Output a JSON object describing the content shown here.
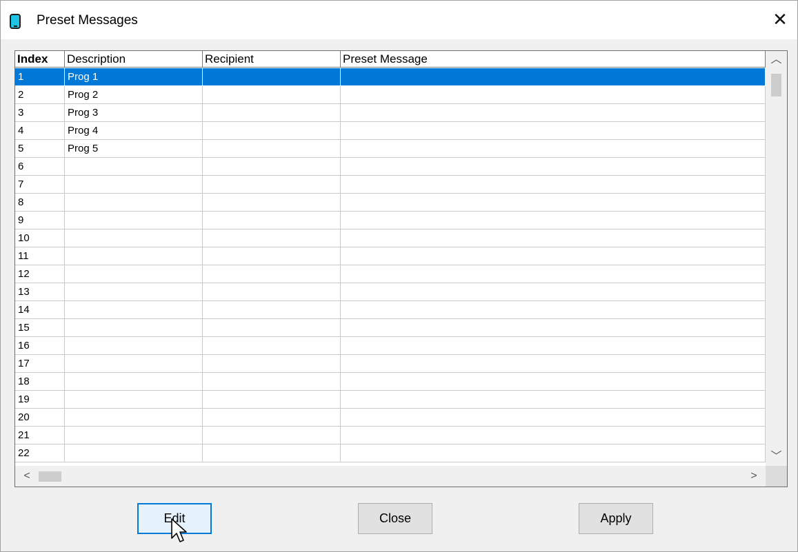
{
  "window": {
    "title": "Preset Messages",
    "icon": "mobile-device-icon",
    "close_icon": "close-icon"
  },
  "table": {
    "columns": [
      "Index",
      "Description",
      "Recipient",
      "Preset Message"
    ],
    "selected_index": 0,
    "rows": [
      [
        "1",
        "Prog 1",
        "",
        ""
      ],
      [
        "2",
        "Prog 2",
        "",
        ""
      ],
      [
        "3",
        "Prog 3",
        "",
        ""
      ],
      [
        "4",
        "Prog 4",
        "",
        ""
      ],
      [
        "5",
        "Prog 5",
        "",
        ""
      ],
      [
        "6",
        "",
        "",
        ""
      ],
      [
        "7",
        "",
        "",
        ""
      ],
      [
        "8",
        "",
        "",
        ""
      ],
      [
        "9",
        "",
        "",
        ""
      ],
      [
        "10",
        "",
        "",
        ""
      ],
      [
        "11",
        "",
        "",
        ""
      ],
      [
        "12",
        "",
        "",
        ""
      ],
      [
        "13",
        "",
        "",
        ""
      ],
      [
        "14",
        "",
        "",
        ""
      ],
      [
        "15",
        "",
        "",
        ""
      ],
      [
        "16",
        "",
        "",
        ""
      ],
      [
        "17",
        "",
        "",
        ""
      ],
      [
        "18",
        "",
        "",
        ""
      ],
      [
        "19",
        "",
        "",
        ""
      ],
      [
        "20",
        "",
        "",
        ""
      ],
      [
        "21",
        "",
        "",
        ""
      ],
      [
        "22",
        "",
        "",
        ""
      ]
    ]
  },
  "buttons": {
    "edit": "Edit",
    "close": "Close",
    "apply": "Apply"
  },
  "colors": {
    "selection": "#0078d7",
    "focus_border": "#0078d7",
    "icon_fill": "#1fc3e6"
  }
}
